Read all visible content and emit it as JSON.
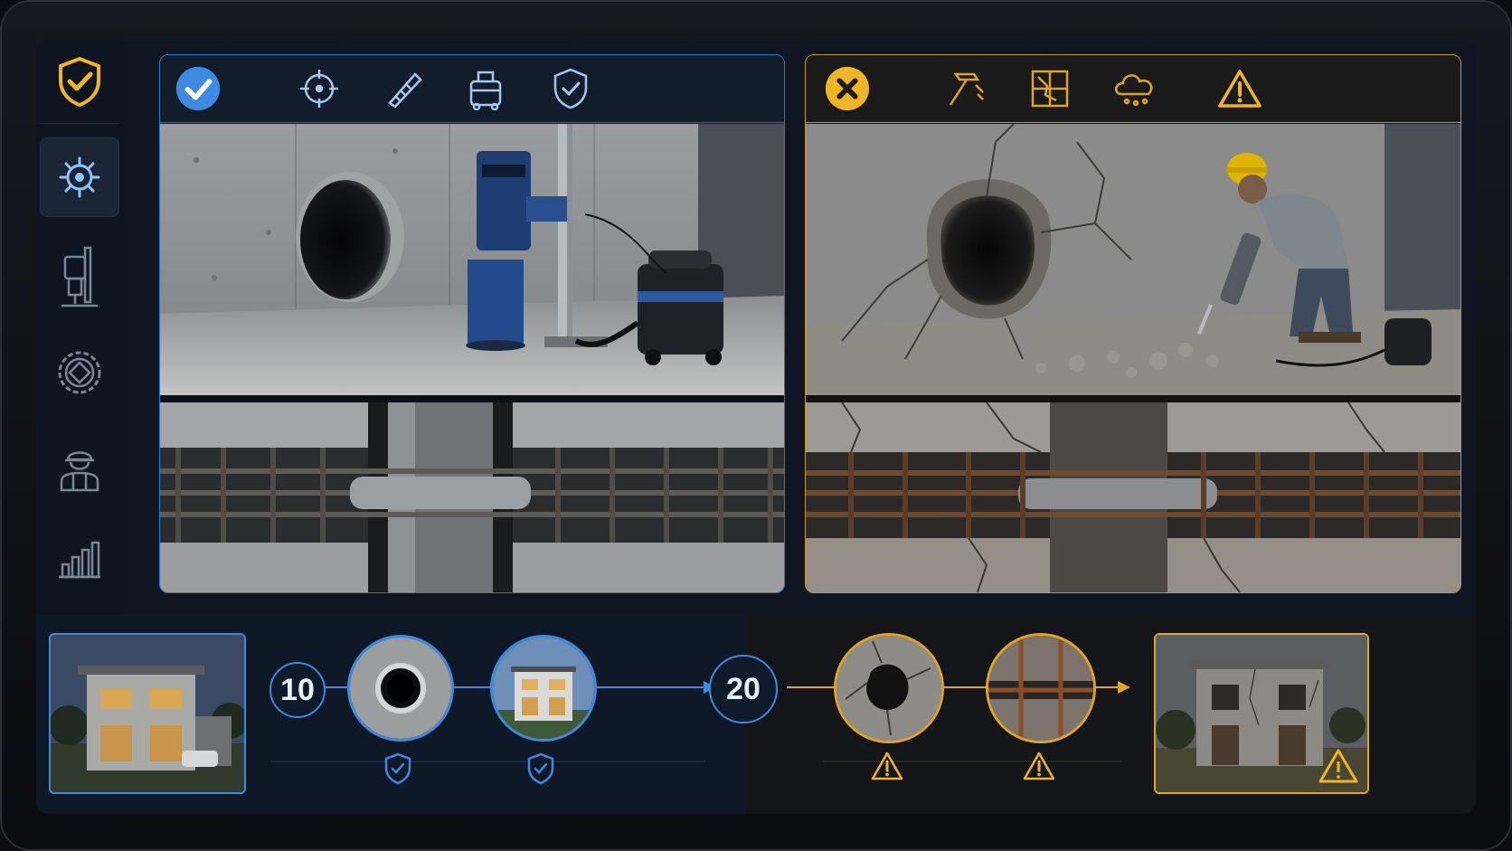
{
  "app": {
    "logo_icon": "shield-check-icon",
    "accent_good": "#3d8ae0",
    "accent_bad": "#f0b429"
  },
  "sidebar": {
    "items": [
      {
        "icon": "target-gear-icon",
        "active": true
      },
      {
        "icon": "core-drill-icon",
        "active": false
      },
      {
        "icon": "diamond-blade-icon",
        "active": false
      },
      {
        "icon": "worker-icon",
        "active": false
      },
      {
        "icon": "bar-chart-icon",
        "active": false
      }
    ]
  },
  "good_panel": {
    "status_icon": "check-circle-icon",
    "tools": [
      "crosshair-icon",
      "core-bit-icon",
      "vacuum-icon",
      "shield-check-icon"
    ],
    "top_image": "core-drilled-clean-hole-photo",
    "bottom_image": "intact-rebar-cross-section-photo"
  },
  "bad_panel": {
    "status_icon": "x-circle-icon",
    "tools": [
      "hammer-icon",
      "cracked-grid-icon",
      "dust-cloud-icon",
      "warning-icon"
    ],
    "top_image": "jackhammer-broken-hole-photo",
    "bottom_image": "damaged-rebar-cross-section-photo"
  },
  "timeline": {
    "good_years": "10",
    "bad_years": "20",
    "good_steps": [
      "clean-core-hole",
      "healthy-house"
    ],
    "bad_steps": [
      "cracked-hole",
      "rusted-rebar"
    ],
    "good_badges": [
      "shield-check-icon",
      "shield-check-icon"
    ],
    "bad_badges": [
      "warning-icon",
      "warning-icon"
    ]
  }
}
